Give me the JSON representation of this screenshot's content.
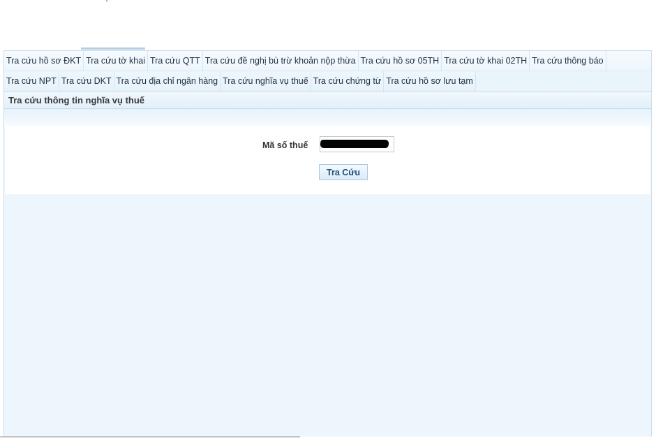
{
  "tabs": {
    "row1": [
      "Tra cứu hồ sơ ĐKT",
      "Tra cứu tờ khai",
      "Tra cứu QTT",
      "Tra cứu đề nghị bù trừ khoản nộp thừa",
      "Tra cứu hồ sơ 05TH",
      "Tra cứu tờ khai 02TH",
      "Tra cứu thông báo"
    ],
    "row2": [
      "Tra cứu NPT",
      "Tra cứu DKT",
      "Tra cứu địa chỉ ngân hàng",
      "Tra cứu nghĩa vụ thuế",
      "Tra cứu chứng từ",
      "Tra cứu hồ sơ lưu tạm"
    ],
    "active": "Tra cứu tờ khai"
  },
  "section": {
    "title": "Tra cứu thông tin nghĩa vụ thuế"
  },
  "form": {
    "tax_code_label": "Mã số thuế",
    "tax_code_value": "",
    "search_label": "Tra Cứu"
  },
  "colors": {
    "background": "#edf6fc",
    "tab_border": "#c7dcec",
    "button_text": "#1f4e79"
  }
}
